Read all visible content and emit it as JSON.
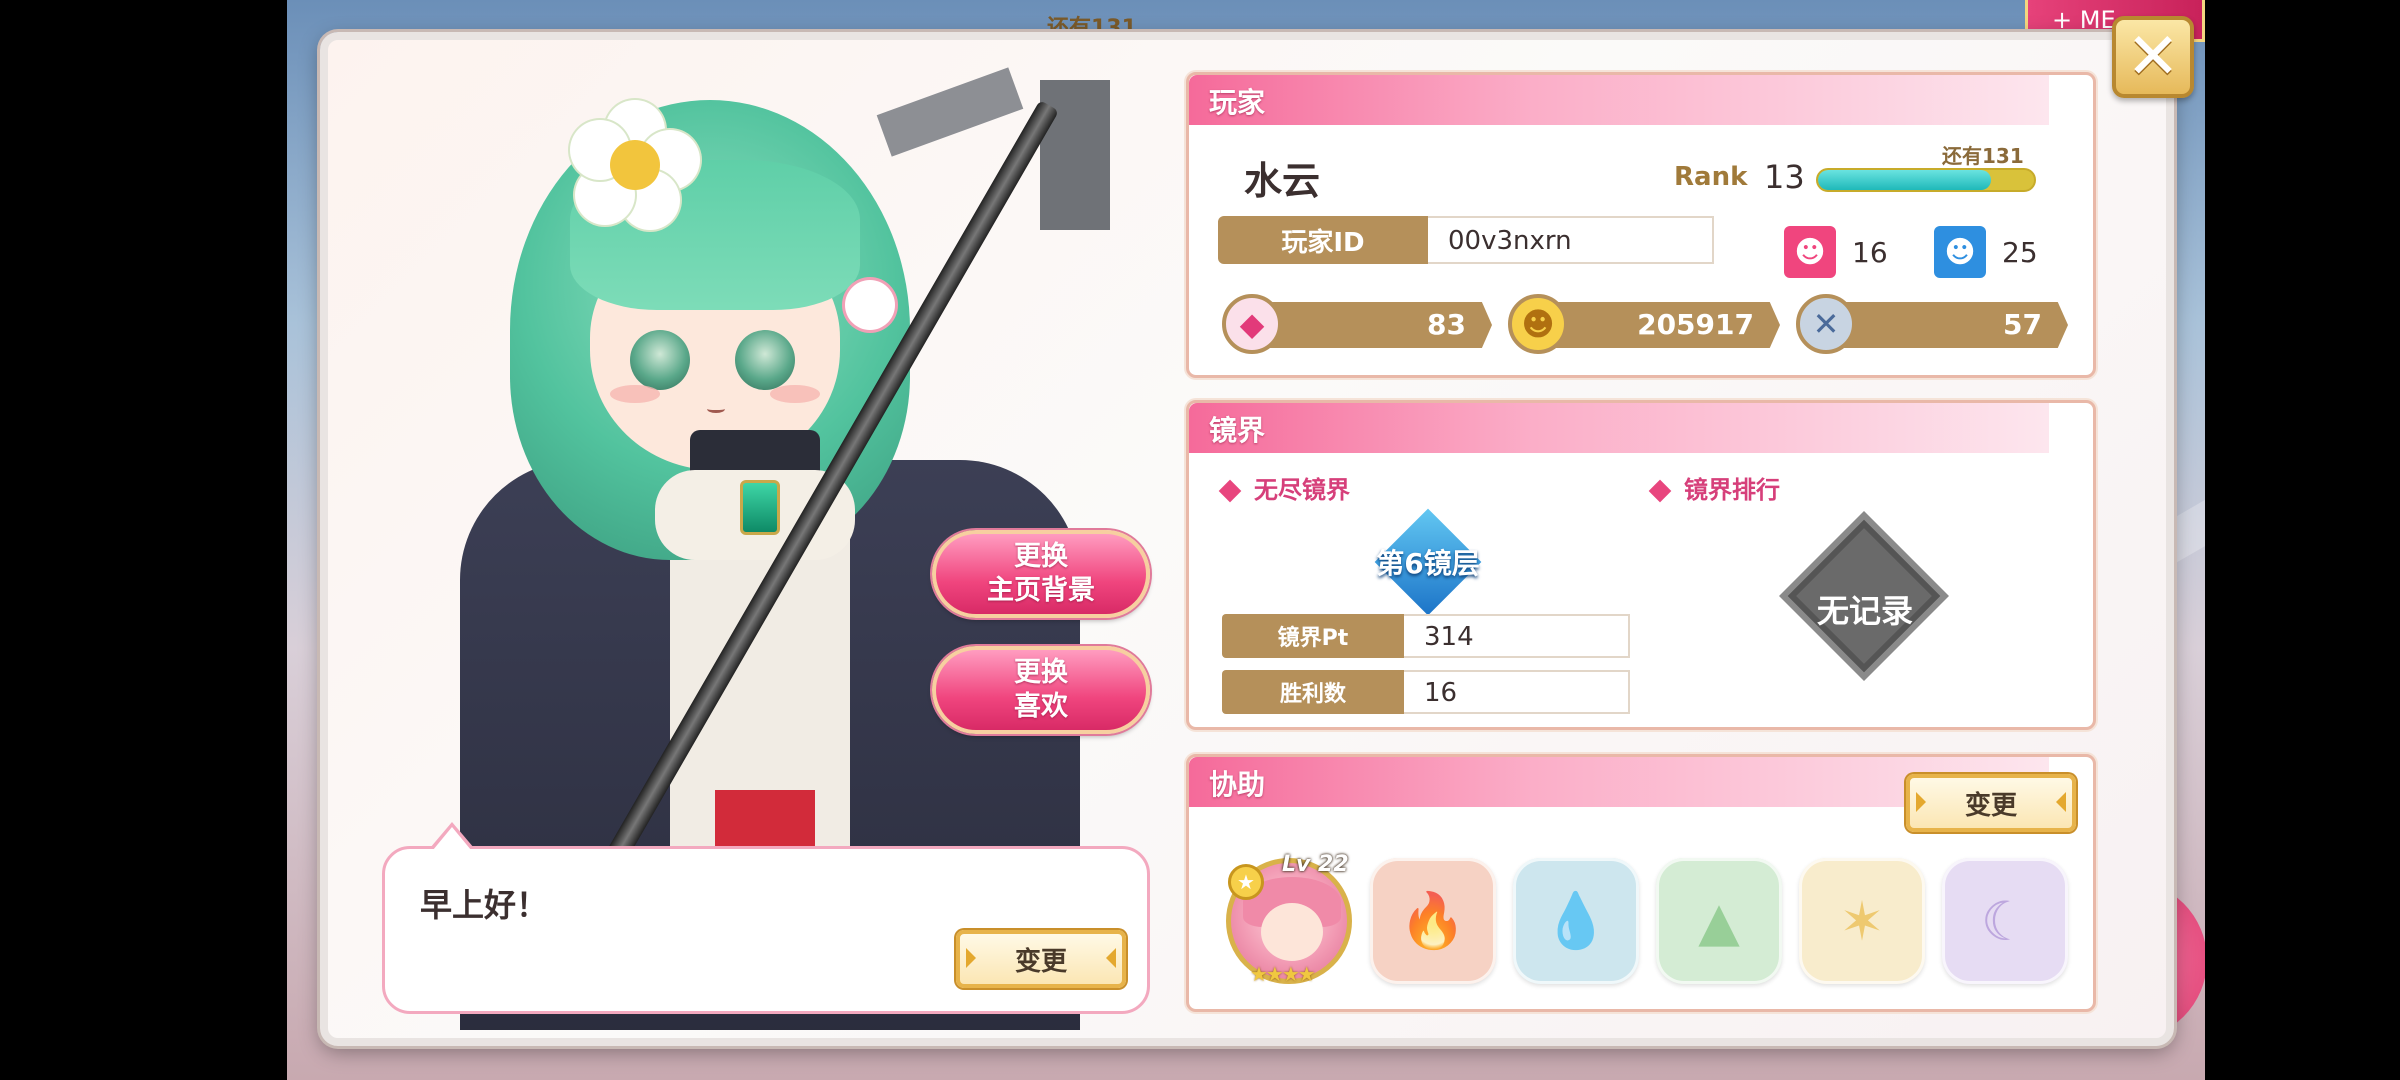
{
  "background": {
    "top_label": "还有131",
    "top_right_label": "+ ME"
  },
  "greeting": "早上好！",
  "buttons": {
    "change_bg": "更换\n主页背景",
    "change_fav": "更换\n喜欢",
    "change_greeting": "变更",
    "change_support": "变更",
    "close": "✕"
  },
  "player": {
    "header": "玩家",
    "name": "水云",
    "rank_label": "Rank",
    "rank": "13",
    "rank_remaining": "还有131",
    "rank_progress": 0.8,
    "id_label": "玩家ID",
    "id_value": "00v3nxrn",
    "follow_count": "16",
    "follower_count": "25",
    "gems": "83",
    "coins": "205917",
    "tickets": "57",
    "colors": {
      "follow": "#f0457e",
      "follower": "#2e8fe0",
      "gold": "#b5905a"
    }
  },
  "mirror": {
    "header": "镜界",
    "endless_label": "无尽镜界",
    "ranking_label": "镜界排行",
    "floor": "第6镜层",
    "no_record": "无记录",
    "pt_label": "镜界Pt",
    "pt_value": "314",
    "wins_label": "胜利数",
    "wins_value": "16"
  },
  "support": {
    "header": "协助",
    "char_level": "Lv 22",
    "char_stars": "★★★★",
    "slots": [
      {
        "element": "fire",
        "icon": "🔥",
        "color": "#f6d2c4",
        "glyph_color": "#f29a80"
      },
      {
        "element": "water",
        "icon": "💧",
        "color": "#cde6ee",
        "glyph_color": "#7fbcd4"
      },
      {
        "element": "wood",
        "icon": "▲",
        "color": "#d4ecd4",
        "glyph_color": "#8ac98a"
      },
      {
        "element": "light",
        "icon": "✶",
        "color": "#f8eccc",
        "glyph_color": "#ecc15a"
      },
      {
        "element": "dark",
        "icon": "☾",
        "color": "#e6dcf3",
        "glyph_color": "#b39ad9"
      }
    ]
  }
}
